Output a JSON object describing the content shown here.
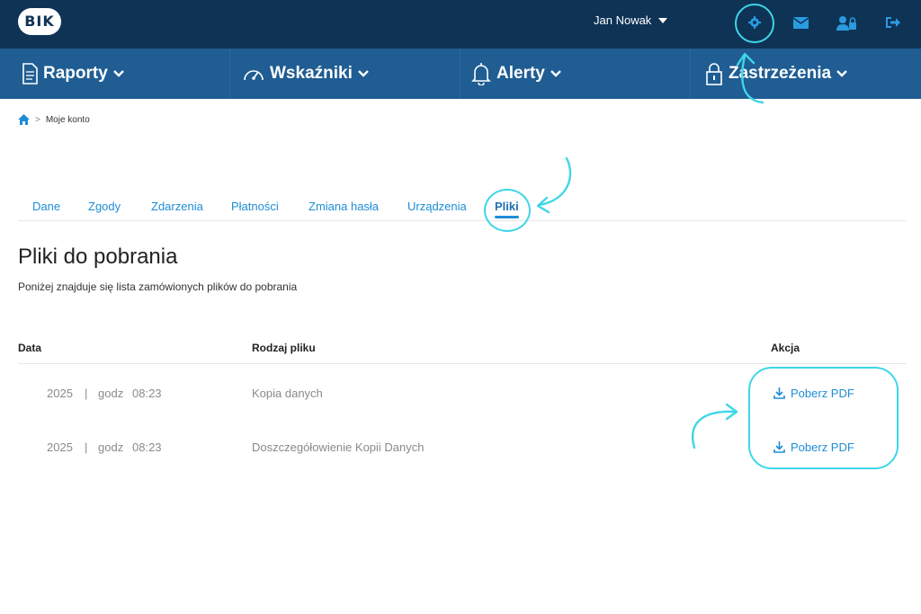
{
  "header": {
    "logo": "BIK",
    "user_name": "Jan Nowak",
    "icons": [
      "gear-icon",
      "mail-icon",
      "user-lock-icon",
      "logout-icon"
    ]
  },
  "nav": {
    "items": [
      {
        "label": "Raporty",
        "icon": "document-icon"
      },
      {
        "label": "Wskaźniki",
        "icon": "gauge-icon"
      },
      {
        "label": "Alerty",
        "icon": "bell-icon"
      },
      {
        "label": "Zastrzeżenia",
        "icon": "padlock-icon"
      }
    ]
  },
  "breadcrumb": {
    "separator": ">",
    "current": "Moje konto"
  },
  "tabs": [
    "Dane",
    "Zgody",
    "Zdarzenia",
    "Płatności",
    "Zmiana hasła",
    "Urządzenia",
    "Pliki"
  ],
  "active_tab": "Pliki",
  "page": {
    "title": "Pliki do pobrania",
    "description": "Poniżej znajduje się lista zamówionych plików do pobrania"
  },
  "table": {
    "headers": {
      "date": "Data",
      "type": "Rodzaj pliku",
      "action": "Akcja"
    },
    "rows": [
      {
        "year": "2025",
        "sep": "|",
        "godz": "godz",
        "time": "08:23",
        "type": "Kopia danych",
        "action": "Poberz PDF"
      },
      {
        "year": "2025",
        "sep": "|",
        "godz": "godz",
        "time": "08:23",
        "type": "Doszczegółowienie Kopii Danych",
        "action": "Poberz PDF"
      }
    ]
  },
  "colors": {
    "topbar": "#0e3355",
    "nav": "#1f5d93",
    "link": "#1f8dd6",
    "annotation": "#3ed6e8"
  }
}
